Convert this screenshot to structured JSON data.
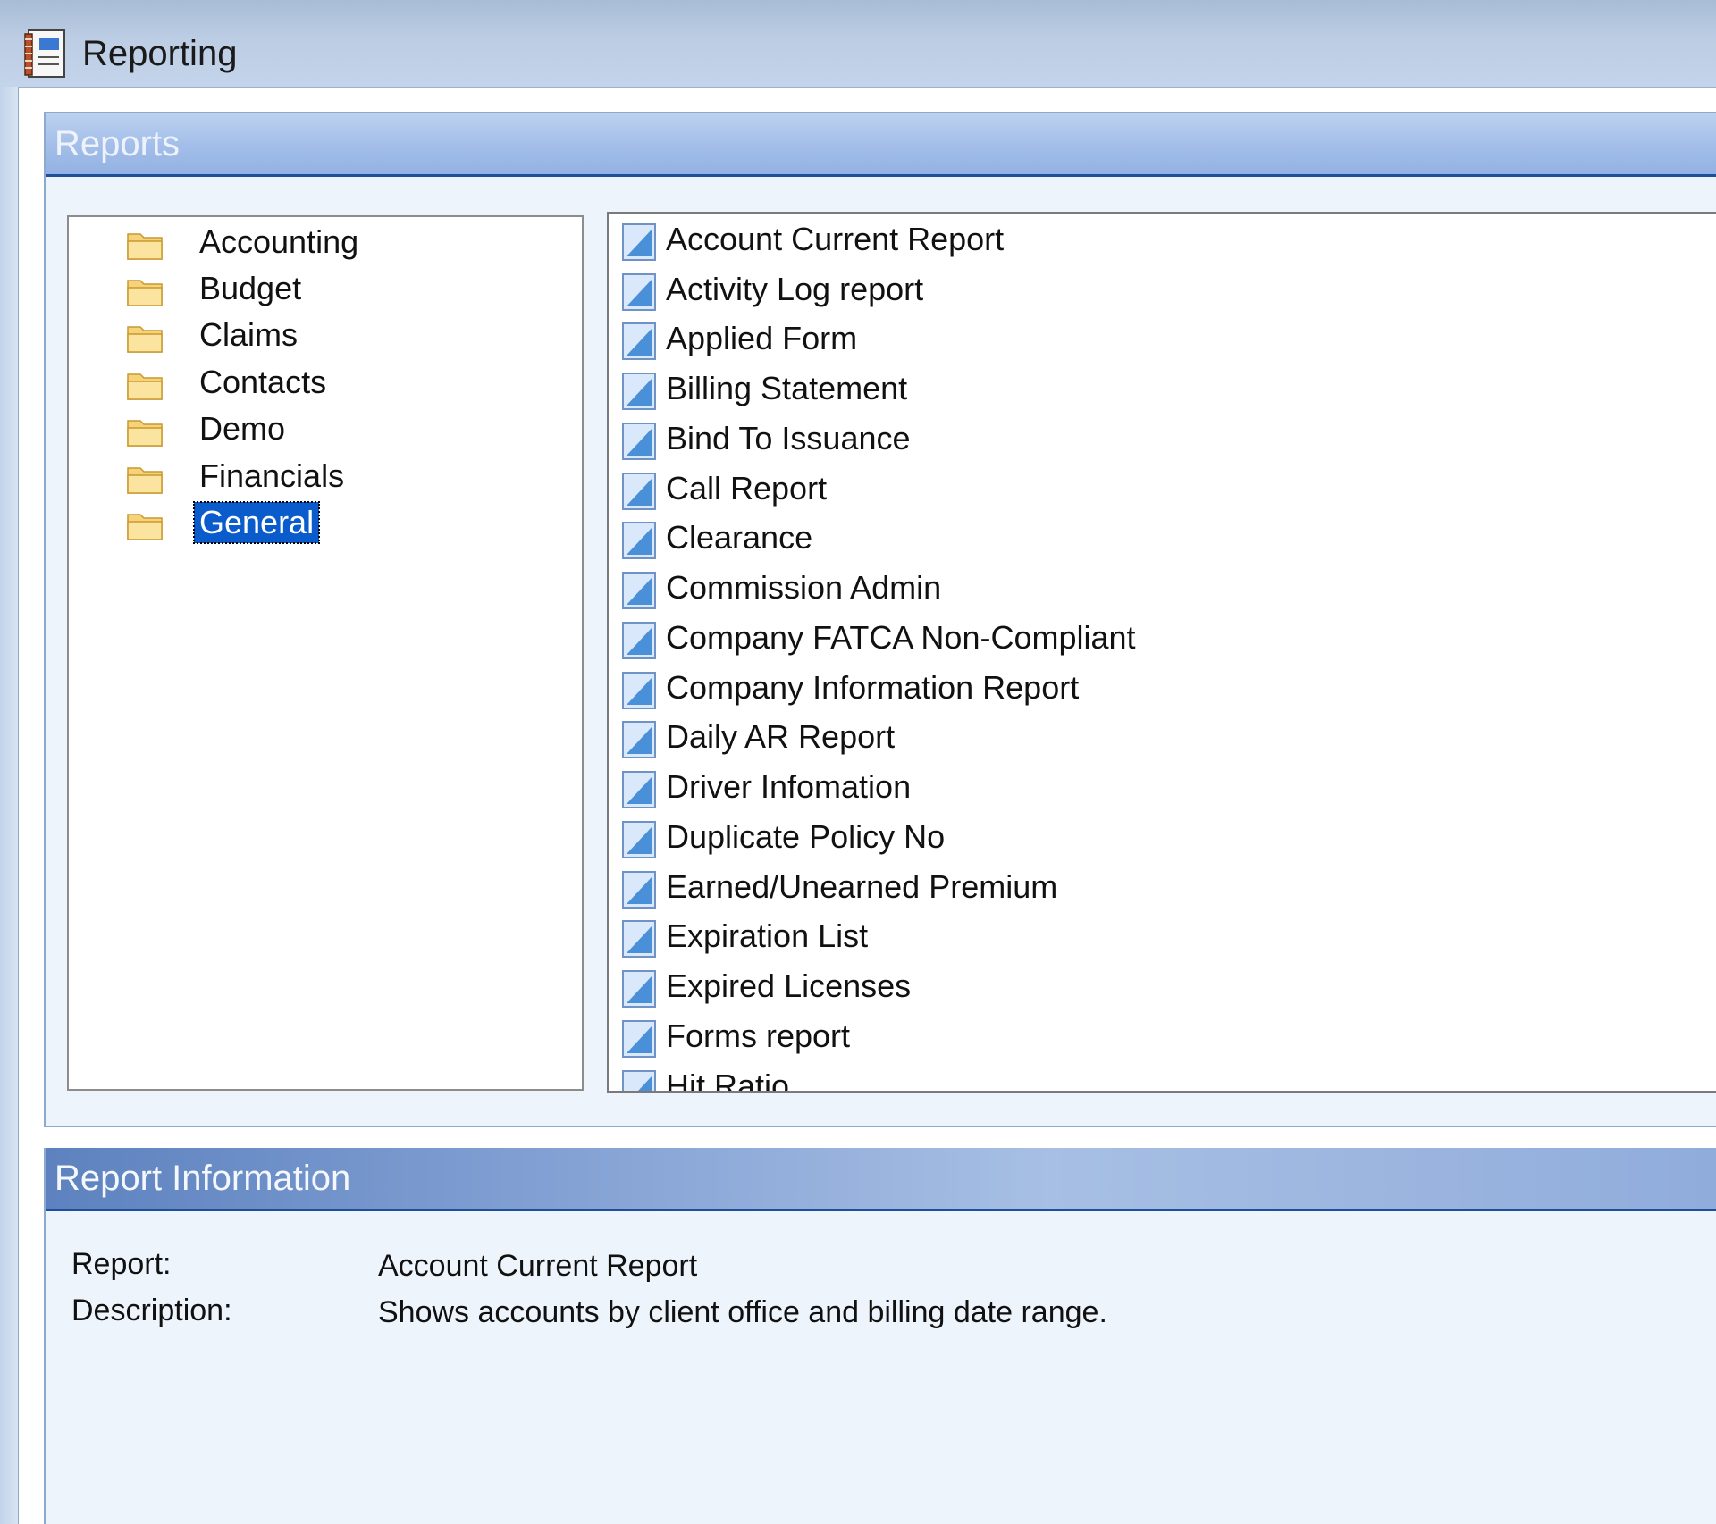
{
  "window": {
    "title": "Reporting"
  },
  "reports_group": {
    "header": "Reports",
    "categories": [
      {
        "label": "Accounting"
      },
      {
        "label": "Budget"
      },
      {
        "label": "Claims"
      },
      {
        "label": "Contacts"
      },
      {
        "label": "Demo"
      },
      {
        "label": "Financials"
      },
      {
        "label": "General"
      }
    ],
    "selected_category": "General",
    "reports": [
      {
        "label": "Account Current Report"
      },
      {
        "label": "Activity Log report"
      },
      {
        "label": "Applied Form"
      },
      {
        "label": "Billing Statement"
      },
      {
        "label": "Bind To Issuance"
      },
      {
        "label": "Call Report"
      },
      {
        "label": "Clearance"
      },
      {
        "label": "Commission Admin"
      },
      {
        "label": "Company FATCA Non-Compliant"
      },
      {
        "label": "Company Information Report"
      },
      {
        "label": "Daily AR Report"
      },
      {
        "label": "Driver Infomation"
      },
      {
        "label": "Duplicate Policy No"
      },
      {
        "label": "Earned/Unearned Premium"
      },
      {
        "label": "Expiration List"
      },
      {
        "label": "Expired Licenses"
      },
      {
        "label": "Forms report"
      },
      {
        "label": "Hit Ratio"
      }
    ],
    "selected_report": "Account Current Report"
  },
  "report_info": {
    "header": "Report Information",
    "report_label": "Report:",
    "report_value": "Account Current Report",
    "description_label": "Description:",
    "description_value": "Shows accounts by client office and billing date range."
  }
}
